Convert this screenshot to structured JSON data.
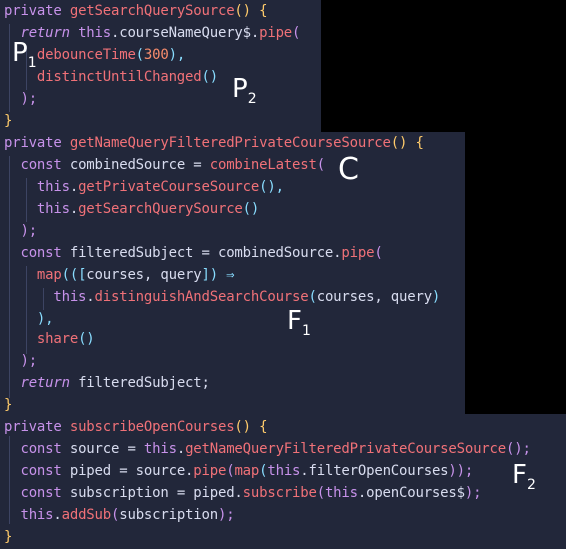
{
  "code": {
    "lines": [
      [
        {
          "t": "private ",
          "c": "kw"
        },
        {
          "t": "getSearchQuerySource",
          "c": "fn"
        },
        {
          "t": "() {",
          "c": "br"
        }
      ],
      [
        {
          "t": "  ",
          "c": "pl"
        },
        {
          "t": "return ",
          "c": "kw it"
        },
        {
          "t": "this",
          "c": "kw"
        },
        {
          "t": ".courseNameQuery$.",
          "c": "pl"
        },
        {
          "t": "pipe",
          "c": "fn"
        },
        {
          "t": "(",
          "c": "kw"
        }
      ],
      [
        {
          "t": "    ",
          "c": "pl"
        },
        {
          "t": "debounceTime",
          "c": "fn"
        },
        {
          "t": "(",
          "c": "pu"
        },
        {
          "t": "300",
          "c": "num"
        },
        {
          "t": "),",
          "c": "pu"
        }
      ],
      [
        {
          "t": "    ",
          "c": "pl"
        },
        {
          "t": "distinctUntilChanged",
          "c": "fn"
        },
        {
          "t": "()",
          "c": "pu"
        }
      ],
      [
        {
          "t": "  ",
          "c": "pl"
        },
        {
          "t": ");",
          "c": "kw"
        }
      ],
      [
        {
          "t": "}",
          "c": "br"
        }
      ],
      [
        {
          "t": "private ",
          "c": "kw"
        },
        {
          "t": "getNameQueryFilteredPrivateCourseSource",
          "c": "fn"
        },
        {
          "t": "() {",
          "c": "br"
        }
      ],
      [
        {
          "t": "  ",
          "c": "pl"
        },
        {
          "t": "const ",
          "c": "kw"
        },
        {
          "t": "combinedSource = ",
          "c": "pl"
        },
        {
          "t": "combineLatest",
          "c": "fn"
        },
        {
          "t": "(",
          "c": "kw"
        }
      ],
      [
        {
          "t": "    ",
          "c": "pl"
        },
        {
          "t": "this",
          "c": "kw"
        },
        {
          "t": ".",
          "c": "pl"
        },
        {
          "t": "getPrivateCourseSource",
          "c": "fn"
        },
        {
          "t": "(),",
          "c": "pu"
        }
      ],
      [
        {
          "t": "    ",
          "c": "pl"
        },
        {
          "t": "this",
          "c": "kw"
        },
        {
          "t": ".",
          "c": "pl"
        },
        {
          "t": "getSearchQuerySource",
          "c": "fn"
        },
        {
          "t": "()",
          "c": "pu"
        }
      ],
      [
        {
          "t": "  ",
          "c": "pl"
        },
        {
          "t": ");",
          "c": "kw"
        }
      ],
      [
        {
          "t": "  ",
          "c": "pl"
        },
        {
          "t": "const ",
          "c": "kw"
        },
        {
          "t": "filteredSubject = combinedSource.",
          "c": "pl"
        },
        {
          "t": "pipe",
          "c": "fn"
        },
        {
          "t": "(",
          "c": "kw"
        }
      ],
      [
        {
          "t": "    ",
          "c": "pl"
        },
        {
          "t": "map",
          "c": "fn"
        },
        {
          "t": "(([",
          "c": "pu"
        },
        {
          "t": "courses, query",
          "c": "pl"
        },
        {
          "t": "]) ⇒",
          "c": "pu"
        }
      ],
      [
        {
          "t": "      ",
          "c": "pl"
        },
        {
          "t": "this",
          "c": "kw"
        },
        {
          "t": ".",
          "c": "pl"
        },
        {
          "t": "distinguishAndSearchCourse",
          "c": "fn"
        },
        {
          "t": "(",
          "c": "pu"
        },
        {
          "t": "courses, query",
          "c": "pl"
        },
        {
          "t": ")",
          "c": "pu"
        }
      ],
      [
        {
          "t": "    ",
          "c": "pl"
        },
        {
          "t": "),",
          "c": "pu"
        }
      ],
      [
        {
          "t": "    ",
          "c": "pl"
        },
        {
          "t": "share",
          "c": "fn"
        },
        {
          "t": "()",
          "c": "pu"
        }
      ],
      [
        {
          "t": "  ",
          "c": "pl"
        },
        {
          "t": ");",
          "c": "kw"
        }
      ],
      [
        {
          "t": "  ",
          "c": "pl"
        },
        {
          "t": "return ",
          "c": "kw it"
        },
        {
          "t": "filteredSubject;",
          "c": "pl"
        }
      ],
      [
        {
          "t": "}",
          "c": "br"
        }
      ],
      [
        {
          "t": "private ",
          "c": "kw"
        },
        {
          "t": "subscribeOpenCourses",
          "c": "fn"
        },
        {
          "t": "() {",
          "c": "br"
        }
      ],
      [
        {
          "t": "  ",
          "c": "pl"
        },
        {
          "t": "const ",
          "c": "kw"
        },
        {
          "t": "source = ",
          "c": "pl"
        },
        {
          "t": "this",
          "c": "kw"
        },
        {
          "t": ".",
          "c": "pl"
        },
        {
          "t": "getNameQueryFilteredPrivateCourseSource",
          "c": "fn"
        },
        {
          "t": "();",
          "c": "kw"
        }
      ],
      [
        {
          "t": "  ",
          "c": "pl"
        },
        {
          "t": "const ",
          "c": "kw"
        },
        {
          "t": "piped = source.",
          "c": "pl"
        },
        {
          "t": "pipe",
          "c": "fn"
        },
        {
          "t": "(",
          "c": "kw"
        },
        {
          "t": "map",
          "c": "fn"
        },
        {
          "t": "(",
          "c": "pu"
        },
        {
          "t": "this",
          "c": "kw"
        },
        {
          "t": ".filterOpenCourses",
          "c": "pl"
        },
        {
          "t": "));",
          "c": "kw"
        }
      ],
      [
        {
          "t": "  ",
          "c": "pl"
        },
        {
          "t": "const ",
          "c": "kw"
        },
        {
          "t": "subscription = piped.",
          "c": "pl"
        },
        {
          "t": "subscribe",
          "c": "fn"
        },
        {
          "t": "(",
          "c": "kw"
        },
        {
          "t": "this",
          "c": "kw"
        },
        {
          "t": ".openCourses$",
          "c": "pl"
        },
        {
          "t": ");",
          "c": "kw"
        }
      ],
      [
        {
          "t": "  ",
          "c": "pl"
        },
        {
          "t": "this",
          "c": "kw"
        },
        {
          "t": ".",
          "c": "pl"
        },
        {
          "t": "addSub",
          "c": "fn"
        },
        {
          "t": "(",
          "c": "kw"
        },
        {
          "t": "subscription",
          "c": "pl"
        },
        {
          "t": ");",
          "c": "kw"
        }
      ],
      [
        {
          "t": "}",
          "c": "br"
        }
      ]
    ]
  },
  "annotations": {
    "p1": {
      "letter": "P",
      "sub": "1"
    },
    "p2": {
      "letter": "P",
      "sub": "2"
    },
    "c": {
      "letter": "C"
    },
    "f1": {
      "letter": "F",
      "sub": "1"
    },
    "f2": {
      "letter": "F",
      "sub": "2"
    }
  },
  "colors": {
    "background": "#22273a",
    "keyword": "#c792ea",
    "function": "#f07178",
    "plain": "#d8dcef",
    "brace": "#ffcb6b",
    "punctuation": "#89ddff",
    "number": "#f78c6c",
    "annotation_ink": "#ffffff"
  }
}
